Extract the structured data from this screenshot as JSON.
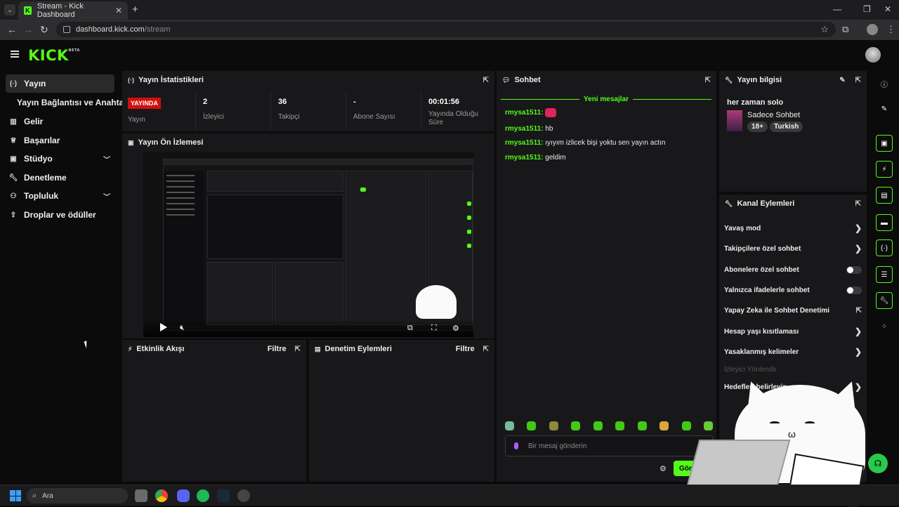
{
  "browser": {
    "tab_title": "Stream - Kick Dashboard",
    "tab_icon": "K",
    "url_host": "dashboard.kick.com",
    "url_path": "/stream"
  },
  "header": {
    "logo": "KICK",
    "logo_tag": "BETA"
  },
  "sidebar": {
    "items": [
      {
        "label": "Yayın",
        "icon": "broadcast-icon"
      },
      {
        "label": "Yayın Bağlantısı ve Anahtarı"
      },
      {
        "label": "Gelir",
        "icon": "revenue-icon"
      },
      {
        "label": "Başarılar",
        "icon": "trophy-icon"
      },
      {
        "label": "Stüdyo",
        "icon": "studio-icon"
      },
      {
        "label": "Denetleme",
        "icon": "wrench-icon"
      },
      {
        "label": "Topluluk",
        "icon": "community-icon"
      },
      {
        "label": "Droplar ve ödüller",
        "icon": "drops-icon"
      }
    ]
  },
  "stats": {
    "title": "Yayın İstatistikleri",
    "live_badge": "YAYINDA",
    "live_label": "Yayın",
    "viewers_value": "2",
    "viewers_label": "İzleyici",
    "followers_value": "36",
    "followers_label": "Takipçi",
    "subs_value": "-",
    "subs_label": "Abone Sayısı",
    "uptime_value": "00:01:56",
    "uptime_label": "Yayında Olduğu Süre"
  },
  "preview": {
    "title": "Yayın Ön İzlemesi"
  },
  "activity": {
    "title": "Etkinlik Akışı",
    "filter": "Filtre"
  },
  "moderation": {
    "title": "Denetim Eylemleri",
    "filter": "Filtre"
  },
  "chat": {
    "title": "Sohbet",
    "new_messages": "Yeni mesajlar",
    "messages": [
      {
        "user": "rmysa1511:",
        "text": ""
      },
      {
        "user": "rmysa1511:",
        "text": "hb"
      },
      {
        "user": "rmysa1511:",
        "text": "ıyıyım izlicek bişi yoktu sen yayın actın"
      },
      {
        "user": "rmysa1511:",
        "text": "geldim"
      }
    ],
    "input_placeholder": "Bir mesaj gönderin",
    "send_label": "Gön"
  },
  "stream_info": {
    "title": "Yayın bilgisi",
    "stream_title": "her zaman solo",
    "category": "Sadece Sohbet",
    "tags": [
      "18+",
      "Turkish"
    ]
  },
  "channel_actions": {
    "title": "Kanal Eylemleri",
    "rows": [
      {
        "label": "Yavaş mod",
        "kind": "chevron"
      },
      {
        "label": "Takipçilere özel sohbet",
        "kind": "chevron"
      },
      {
        "label": "Abonelere özel sohbet",
        "kind": "toggle"
      },
      {
        "label": "Yalnızca ifadelerle sohbet",
        "kind": "toggle"
      },
      {
        "label": "Yapay Zeka ile Sohbet Denetimi",
        "kind": "external"
      },
      {
        "label": "Hesap yaşı kısıtlaması",
        "kind": "chevron"
      },
      {
        "label": "Yasaklanmış kelimeler",
        "kind": "chevron"
      },
      {
        "label": "İzleyici Yönlendir",
        "kind": "disabled"
      },
      {
        "label": "Hedefleri belirleyin",
        "kind": "chevron"
      }
    ]
  },
  "taskbar": {
    "search_placeholder": "Ara"
  },
  "colors": {
    "accent": "#53fc18",
    "live": "#d30e0e",
    "panel": "#18181a"
  }
}
